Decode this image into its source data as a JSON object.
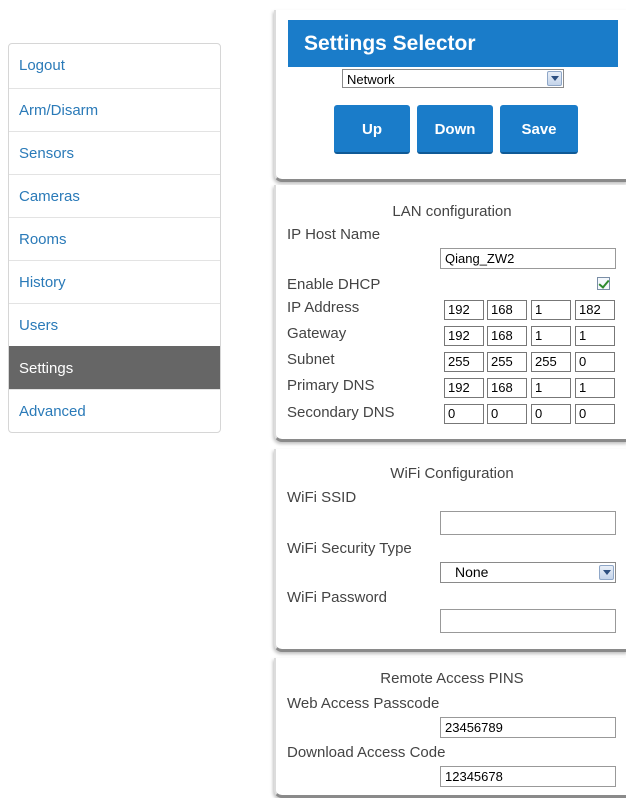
{
  "sidebar": {
    "items": [
      {
        "label": "Logout"
      },
      {
        "label": "Arm/Disarm"
      },
      {
        "label": "Sensors"
      },
      {
        "label": "Cameras"
      },
      {
        "label": "Rooms"
      },
      {
        "label": "History"
      },
      {
        "label": "Users"
      },
      {
        "label": "Settings"
      },
      {
        "label": "Advanced"
      }
    ]
  },
  "selector": {
    "title": "Settings Selector",
    "selected": "Network",
    "up_label": "Up",
    "down_label": "Down",
    "save_label": "Save"
  },
  "lan": {
    "title": "LAN configuration",
    "host_label": "IP Host Name",
    "host_value": "Qiang_ZW2",
    "dhcp_label": "Enable DHCP",
    "dhcp_checked": true,
    "ip_label": "IP Address",
    "ip": [
      "192",
      "168",
      "1",
      "182"
    ],
    "gateway_label": "Gateway",
    "gateway": [
      "192",
      "168",
      "1",
      "1"
    ],
    "subnet_label": "Subnet",
    "subnet": [
      "255",
      "255",
      "255",
      "0"
    ],
    "pdns_label": "Primary DNS",
    "pdns": [
      "192",
      "168",
      "1",
      "1"
    ],
    "sdns_label": "Secondary DNS",
    "sdns": [
      "0",
      "0",
      "0",
      "0"
    ]
  },
  "wifi": {
    "title": "WiFi Configuration",
    "ssid_label": "WiFi SSID",
    "ssid_value": "",
    "security_label": "WiFi Security Type",
    "security_value": "None",
    "password_label": "WiFi Password",
    "password_value": ""
  },
  "remote": {
    "title": "Remote Access PINS",
    "web_label": "Web Access Passcode",
    "web_value": "23456789",
    "download_label": "Download Access Code",
    "download_value": "12345678"
  },
  "colors": {
    "accent": "#1a7cc9",
    "link": "#2a7ab8",
    "active_nav": "#666666"
  }
}
